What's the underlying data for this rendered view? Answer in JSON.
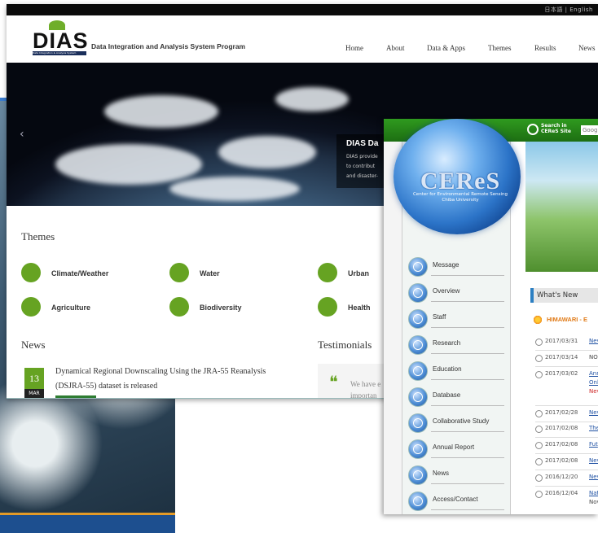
{
  "dias": {
    "lang": "日本語 | English",
    "logo": "DIAS",
    "logo_sub": "Data Integration & Analysis System",
    "program_title": "Data Integration and Analysis System Program",
    "nav": [
      "Home",
      "About",
      "Data & Apps",
      "Themes",
      "Results",
      "News"
    ],
    "hero": {
      "title": "DIAS Da",
      "line1": "DIAS provide",
      "line2": "to contribut",
      "line3": "and disaster-"
    },
    "themes_title": "Themes",
    "themes": [
      "Climate/Weather",
      "Water",
      "Urban",
      "Agriculture",
      "Biodiversity",
      "Health"
    ],
    "news_title": "News",
    "news": {
      "day": "13",
      "month": "MAR",
      "text": "Dynamical Regional Downscaling Using the JRA-55 Reanalysis (DSJRA-55) dataset is released"
    },
    "testimonials_title": "Testimonials",
    "testimonial": {
      "quote": "❝",
      "line1": "We have e",
      "line2": "importan"
    },
    "accent_color": "#66a322"
  },
  "ceres": {
    "search_label_1": "Search in",
    "search_label_2": "CEReS Site",
    "search_placeholder": "Goog",
    "logo": "CEReS",
    "logo_sub1": "Center for Environmental Remote Sensing",
    "logo_sub2": "Chiba University",
    "menu": [
      "Message",
      "Overview",
      "Staff",
      "Research",
      "Education",
      "Database",
      "Collaborative Study",
      "Annual Report",
      "News",
      "Access/Contact"
    ],
    "whats_new": "What's New",
    "himawari": "HIMAWARI - E",
    "news": [
      {
        "date": "2017/03/31",
        "text": "Nev"
      },
      {
        "date": "2017/03/14",
        "text": "NO"
      },
      {
        "date": "2017/03/02",
        "text": "Ann",
        "text2": "Onl",
        "text3": "Nev"
      },
      {
        "date": "2017/02/28",
        "text": "Nev"
      },
      {
        "date": "2017/02/08",
        "text": "The"
      },
      {
        "date": "2017/02/08",
        "text": "Fut"
      },
      {
        "date": "2017/02/08",
        "text": "Nev"
      },
      {
        "date": "2016/12/20",
        "text": "Nev"
      },
      {
        "date": "2016/12/04",
        "text": "Nat",
        "text2": "Nov"
      }
    ],
    "brand_color": "#2f9a1f"
  }
}
